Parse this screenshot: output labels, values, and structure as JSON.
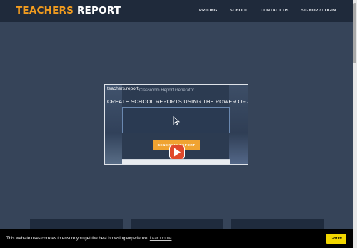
{
  "header": {
    "logo_part1": "TEACHERS",
    "logo_part2": "REPORT",
    "nav": [
      "PRICING",
      "SCHOOL",
      "CONTACT US",
      "SIGNUP / LOGIN"
    ]
  },
  "video": {
    "title": "teachers.report",
    "subtitle": "Classroom Report Generator",
    "headline": "CREATE SCHOOL REPORTS USING THE POWER OF AI",
    "button_label": "GENERATE REPORT",
    "play_icon": "play-icon",
    "cursor_icon": "cursor-icon"
  },
  "cookie_banner": {
    "text": "This website uses cookies to ensure you get the best browsing experience.",
    "link_text": "Learn more",
    "button_label": "Got it!"
  },
  "colors": {
    "background": "#364459",
    "navbar": "#1f2a3b",
    "accent_orange": "#f29c1f",
    "play_red": "#e04a2c",
    "cookie_button": "#f1d600"
  }
}
